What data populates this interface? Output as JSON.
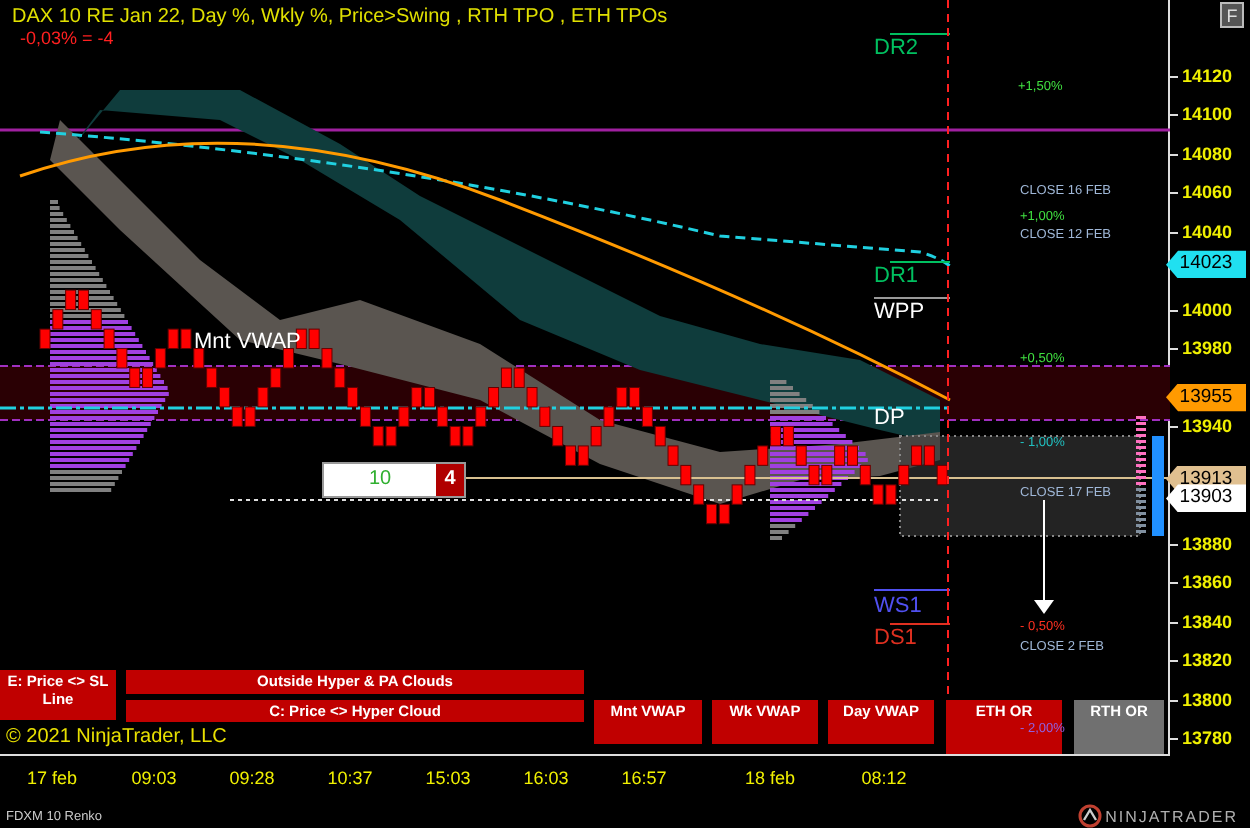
{
  "header": {
    "title": "DAX 10 RE Jan 22, Day %, Wkly %, Price>Swing  , RTH TPO , ETH TPOs",
    "change": "-0,03% = -4"
  },
  "corner_button": "F",
  "chart_labels": [
    {
      "text": "DR2",
      "kind": "level",
      "color": "#00c060"
    },
    {
      "text": "+1,50%",
      "kind": "note",
      "color": "#40e040"
    },
    {
      "text": "CLOSE 16 FEB",
      "kind": "note",
      "color": "#a0b8d8"
    },
    {
      "text": "+1,00%",
      "kind": "note",
      "color": "#40e040"
    },
    {
      "text": "CLOSE 12 FEB",
      "kind": "note",
      "color": "#a0b8d8"
    },
    {
      "text": "DR1",
      "kind": "level",
      "color": "#00c060"
    },
    {
      "text": "WPP",
      "kind": "level",
      "color": "#ffffff"
    },
    {
      "text": "+0,50%",
      "kind": "note",
      "color": "#40e040"
    },
    {
      "text": "DP",
      "kind": "level",
      "color": "#ffffff"
    },
    {
      "text": "- 1,00%",
      "kind": "note",
      "color": "#20c0c0"
    },
    {
      "text": "CLOSE 17 FEB",
      "kind": "note",
      "color": "#a0b8d8"
    },
    {
      "text": "Mnt VWAP",
      "kind": "level",
      "color": "#ffffff"
    },
    {
      "text": "WS1",
      "kind": "level",
      "color": "#5050f0"
    },
    {
      "text": "DS1",
      "kind": "level",
      "color": "#e03020"
    },
    {
      "text": "- 0,50%",
      "kind": "note",
      "color": "#ff3020"
    },
    {
      "text": "CLOSE 2 FEB",
      "kind": "note",
      "color": "#a0b8d8"
    },
    {
      "text": "- 2,00%",
      "kind": "note",
      "color": "#9060e0"
    }
  ],
  "counter": {
    "bricks": "10",
    "count": "4"
  },
  "buttons": [
    {
      "label": "E: Price <> SL Line",
      "on": true
    },
    {
      "label": "Outside Hyper & PA Clouds",
      "on": true
    },
    {
      "label": "C: Price <> Hyper Cloud",
      "on": true
    },
    {
      "label": "Mnt VWAP",
      "on": true
    },
    {
      "label": "Wk VWAP",
      "on": true
    },
    {
      "label": "Day VWAP",
      "on": true
    },
    {
      "label": "ETH OR",
      "on": true
    },
    {
      "label": "RTH OR",
      "on": false
    }
  ],
  "copyright": "© 2021 NinjaTrader, LLC",
  "price_axis": [
    "14120",
    "14100",
    "14080",
    "14060",
    "14040",
    "14000",
    "13980",
    "13940",
    "13880",
    "13860",
    "13840",
    "13820",
    "13800",
    "13780"
  ],
  "price_badges": [
    {
      "value": "14023",
      "color": "#20e0f0"
    },
    {
      "value": "13955",
      "color": "#ff9a00"
    },
    {
      "value": "13913",
      "color": "#e0c090"
    },
    {
      "value": "13903",
      "color": "#ffffff"
    }
  ],
  "time_axis": [
    "17 feb",
    "09:03",
    "09:28",
    "10:37",
    "15:03",
    "16:03",
    "16:57",
    "18 feb",
    "08:12"
  ],
  "instrument": "FDXM 10 Renko",
  "brand": "NINJATRADER"
}
